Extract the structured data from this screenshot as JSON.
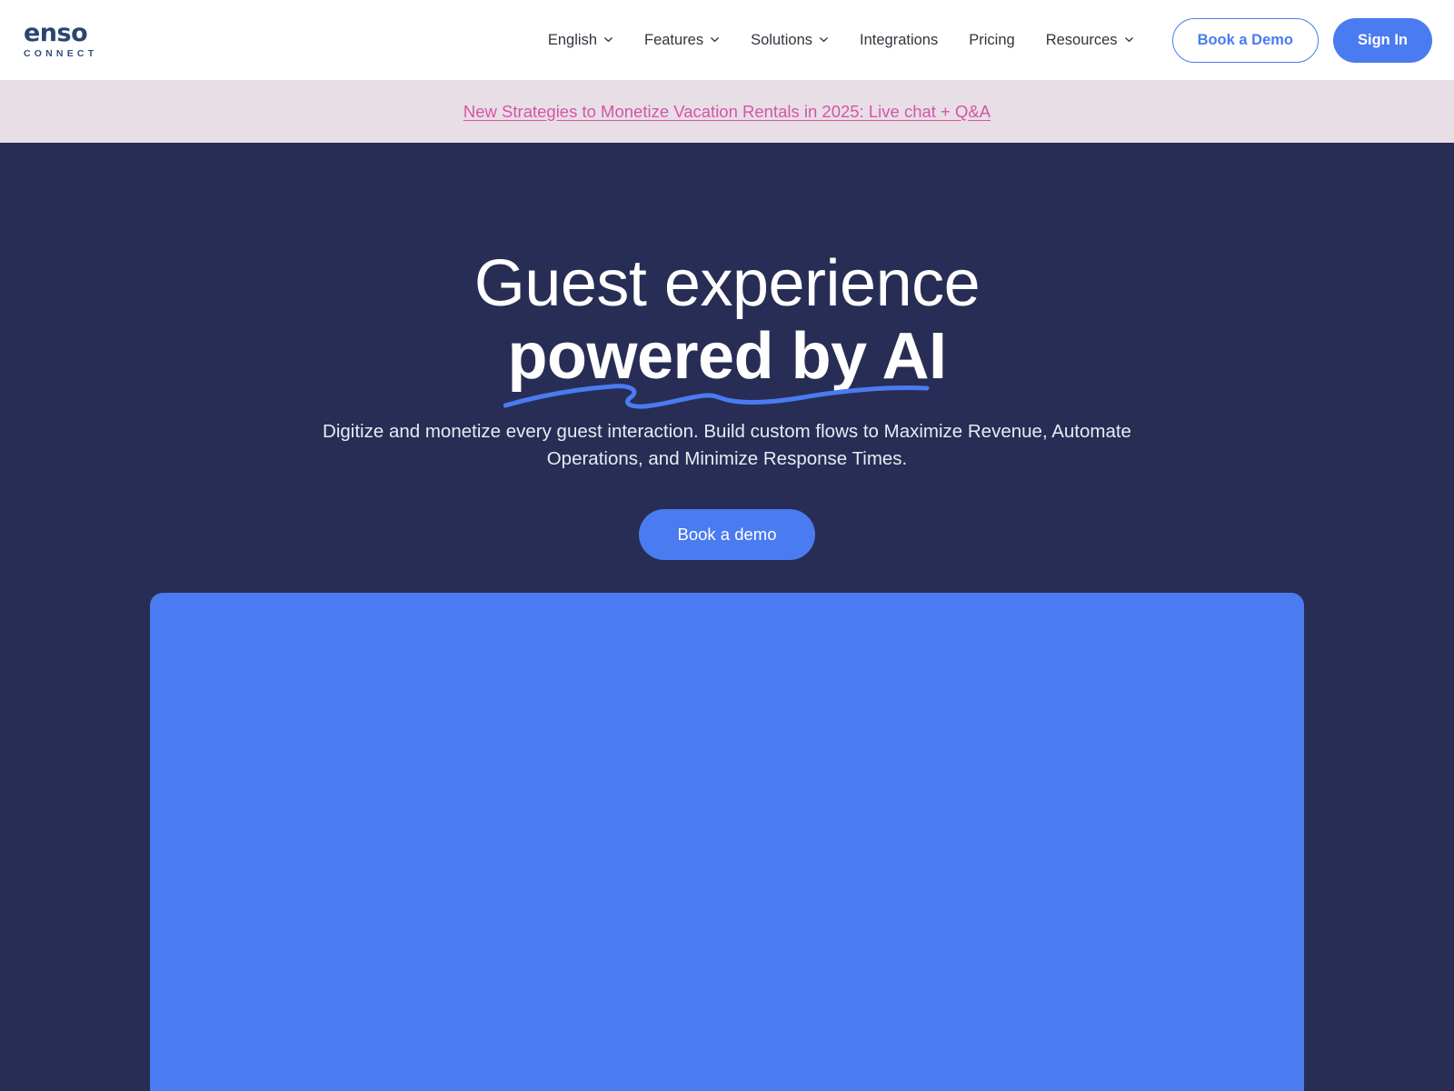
{
  "brand": {
    "logo_mark": "enso",
    "logo_sub": "CONNECT",
    "accent_blue": "#4a7bf0",
    "navy": "#272d54",
    "banner_bg": "#e8dee6",
    "banner_text_color": "#d455a8"
  },
  "nav": {
    "items": [
      {
        "label": "English",
        "has_chevron": true,
        "icon": "chevron-down-icon"
      },
      {
        "label": "Features",
        "has_chevron": true,
        "icon": "chevron-down-icon"
      },
      {
        "label": "Solutions",
        "has_chevron": true,
        "icon": "chevron-down-icon"
      },
      {
        "label": "Integrations",
        "has_chevron": false,
        "icon": ""
      },
      {
        "label": "Pricing",
        "has_chevron": false,
        "icon": ""
      },
      {
        "label": "Resources",
        "has_chevron": true,
        "icon": "chevron-down-icon"
      }
    ],
    "book_demo_label": "Book a Demo",
    "sign_in_label": "Sign In"
  },
  "banner": {
    "text": "New Strategies to Monetize Vacation Rentals in 2025: Live chat + Q&A"
  },
  "hero": {
    "title_line1": "Guest experience",
    "title_line2": "powered by AI",
    "subtitle": "Digitize and monetize every guest interaction. Build custom flows to Maximize Revenue, Automate Operations, and Minimize Response Times.",
    "cta_label": "Book a demo"
  }
}
